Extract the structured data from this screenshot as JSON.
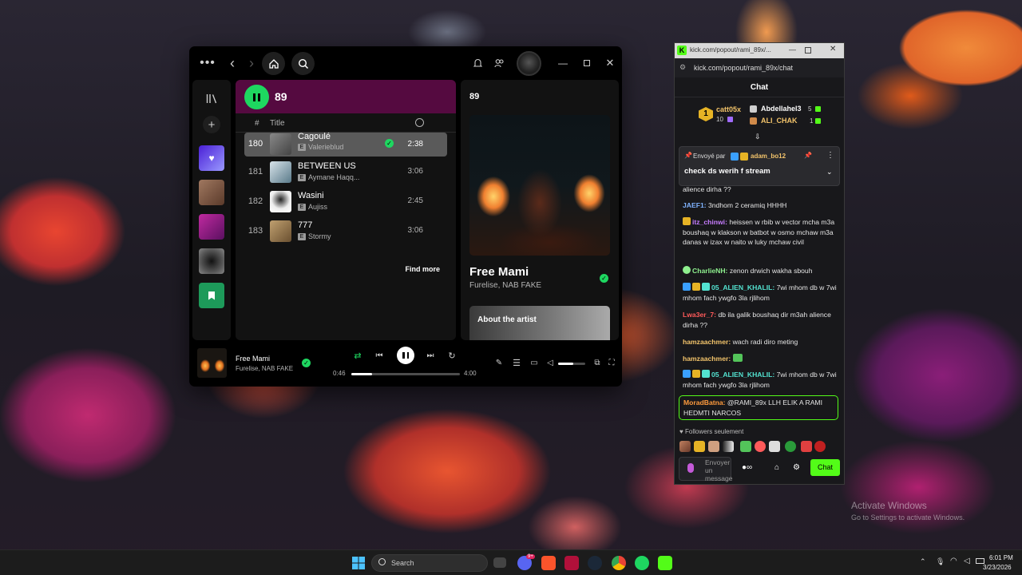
{
  "spotify": {
    "playlist_title": "89",
    "col_hash": "#",
    "col_title": "Title",
    "tracks": [
      {
        "num": "180",
        "title": "Cagoulé",
        "explicit": "E",
        "artist": "Valerieblud",
        "duration": "2:38"
      },
      {
        "num": "181",
        "title": "BETWEEN US",
        "explicit": "E",
        "artist": "Aymane Haqq...",
        "duration": "3:06"
      },
      {
        "num": "182",
        "title": "Wasini",
        "explicit": "E",
        "artist": "Aujiss",
        "duration": "2:45"
      },
      {
        "num": "183",
        "title": "777",
        "explicit": "E",
        "artist": "Stormy",
        "duration": "3:06"
      }
    ],
    "find_more": "Find more",
    "right_panel": {
      "heading": "89",
      "song": "Free Mami",
      "artists": "Furelise, NAB FAKE",
      "about_artist": "About the artist"
    },
    "player": {
      "song": "Free Mami",
      "artists": "Furelise, NAB FAKE",
      "elapsed": "0:46",
      "total": "4:00",
      "progress": 0.19,
      "volume": 0.55
    }
  },
  "kick": {
    "tab_url": "kick.com/popout/rami_89x/...",
    "url": "kick.com/popout/rami_89x/chat",
    "chat_label": "Chat",
    "leaderboard": {
      "rank": "1",
      "first_user": "catt05x",
      "first_count": "10",
      "second_user": "Abdellahel3",
      "second_count": "5",
      "third_user": "ALI_CHAK",
      "third_count": "1"
    },
    "pinned": {
      "sent_by": "Envoyé par",
      "user": "adam_bo12",
      "text": "check ds werih f stream"
    },
    "messages": [
      {
        "user": "",
        "color": "#e5e5e5",
        "text": "alience dirha ??"
      },
      {
        "user": "JAEF1:",
        "color": "#7fb3ff",
        "text": "3ndhom 2 ceramiq HHHH"
      },
      {
        "user": "itz_chinwi:",
        "color": "#c77dff",
        "text": "heissen w rbib w vector mcha m3a boushaq w klakson w batbot w osmo mchaw m3a danas w izax w naito w luky mchaw civil"
      },
      {
        "user": "CharlieNH:",
        "color": "#8ef08e",
        "text": "zenon drwich wakha sbouh"
      },
      {
        "user": "05_ALIEN_KHALIL:",
        "color": "#53e3d1",
        "text": "7wi mhom db w 7wi mhom fach ywgfo 3la rjlihom"
      },
      {
        "user": "Lwa3er_7:",
        "color": "#ff5a5a",
        "text": "db ila galik boushaq dir m3ah alience dirha ??"
      },
      {
        "user": "hamzaachmer:",
        "color": "#f3c46b",
        "text": "wach radi diro meting"
      },
      {
        "user": "hamzaachmer:",
        "color": "#f3c46b",
        "text": ""
      },
      {
        "user": "05_ALIEN_KHALIL:",
        "color": "#53e3d1",
        "text": "7wi mhom db w 7wi mhom fach ywgfo 3la rjlihom"
      },
      {
        "user": "MoradBatna:",
        "color": "#ff9b3d",
        "text": "@RAMI_89x LLH ELIK A RAMI HEDMTI NARCOS"
      }
    ],
    "followers_only": "Followers seulement",
    "input_placeholder": "Envoyer un message",
    "send_button": "Chat"
  },
  "desktop": {
    "watermark_title": "Activate Windows",
    "watermark_sub": "Go to Settings to activate Windows.",
    "search_placeholder": "Search",
    "time": "6:01 PM",
    "date": "3/23/2026",
    "discord_badge": "9+"
  },
  "colors": {
    "spotify_green": "#1ed760",
    "kick_green": "#53fc18",
    "playlist_header": "#550a40"
  }
}
